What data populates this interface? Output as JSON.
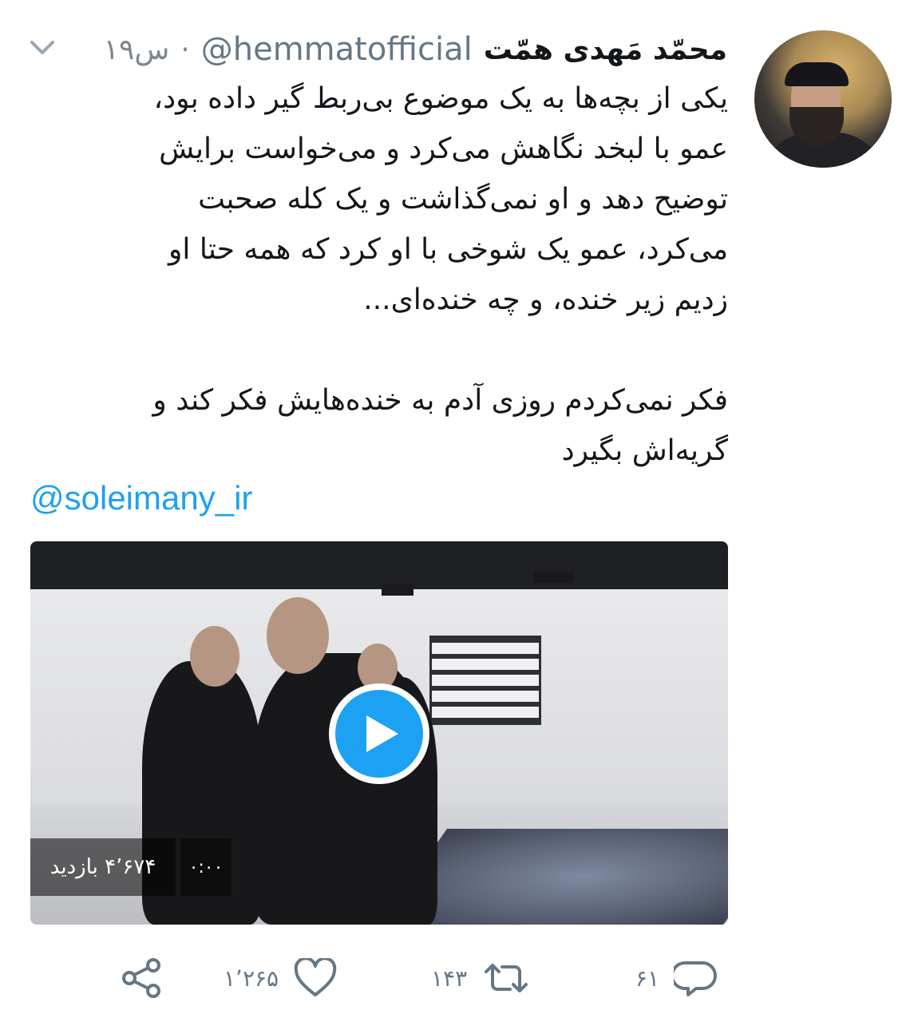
{
  "tweet": {
    "display_name": "محمّد مَهدی همّت",
    "handle": "@hemmatofficial",
    "separator": "·",
    "timestamp": "۱۹س",
    "body": "یکی از بچه‌ها به یک موضوع بی‌ربط گیر داده بود،\nعمو با لبخد نگاهش می‌کرد و می‌خواست برایش\nتوضیح دهد و او نمی‌گذاشت و یک کله صحبت\nمی‌کرد، عمو یک شوخی با او کرد که همه حتا او\nزدیم زیر خنده، و چه خنده‌ای...\n\nفکر نمی‌کردم روزی آدم به خنده‌هایش فکر کند و\nگریه‌اش بگیرد",
    "mention": "@soleimany_ir"
  },
  "media": {
    "views": "۴٬۶۷۴ بازدید",
    "duration": "۰:۰۰"
  },
  "actions": {
    "reply_count": "۶۱",
    "retweet_count": "۱۴۳",
    "like_count": "۱٬۲۶۵"
  },
  "icons": {
    "menu": "chevron-down-icon",
    "play": "play-icon",
    "reply": "reply-icon",
    "retweet": "retweet-icon",
    "like": "heart-icon",
    "share": "share-icon"
  },
  "colors": {
    "accent": "#1da1f2",
    "muted": "#657786",
    "text": "#14171a"
  }
}
